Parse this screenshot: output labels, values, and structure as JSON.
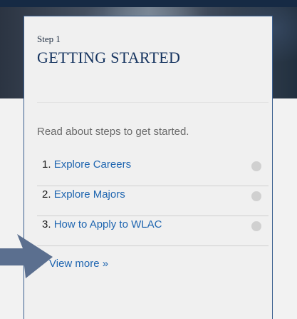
{
  "card": {
    "step_label": "Step 1",
    "title": "GETTING STARTED",
    "intro": "Read about steps to get started."
  },
  "steps": [
    {
      "number": "1.",
      "label": "Explore Careers"
    },
    {
      "number": "2.",
      "label": "Explore Majors"
    },
    {
      "number": "3.",
      "label": "How to Apply to WLAC"
    }
  ],
  "view_more": "View more »",
  "colors": {
    "title": "#15335f",
    "link": "#1e65b0",
    "card_border": "#3b5f8f",
    "arrow": "#5b6f8f"
  }
}
